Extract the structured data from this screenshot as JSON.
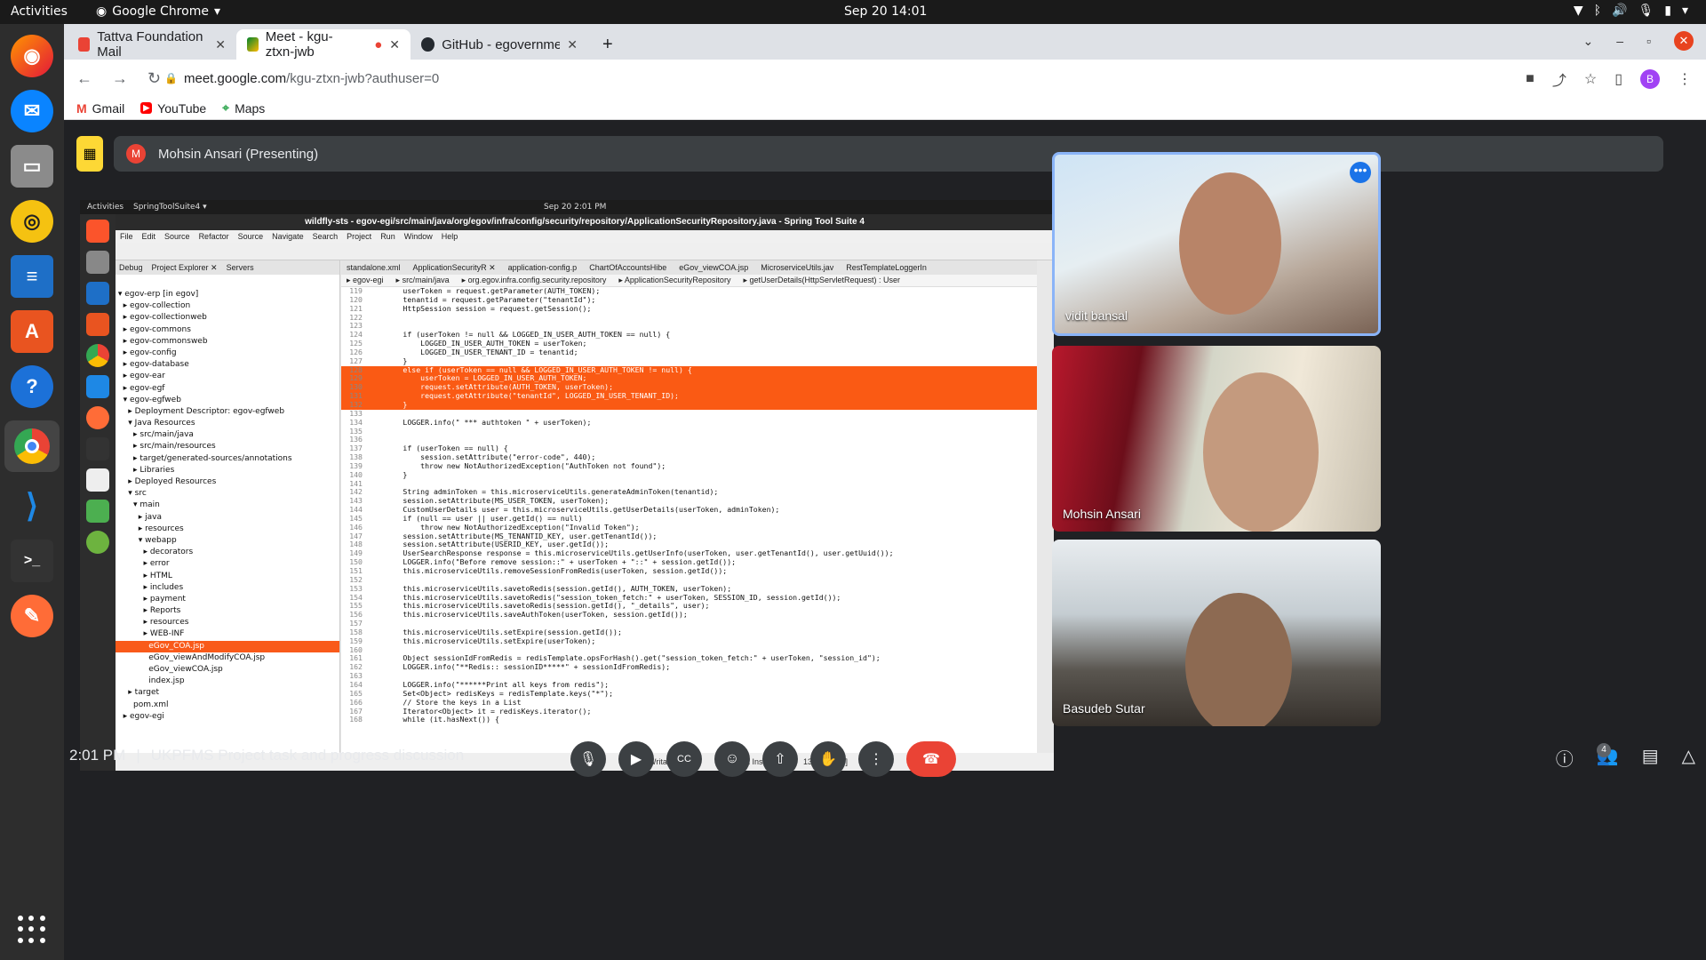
{
  "os": {
    "activities": "Activities",
    "app_name": "Google Chrome",
    "clock": "Sep 20  14:01"
  },
  "browser": {
    "tabs": [
      {
        "label": "Tattva Foundation Mail",
        "color": "#ea4335"
      },
      {
        "label": "Meet - kgu-ztxn-jwb",
        "color": "#00832d"
      },
      {
        "label": "GitHub - egovernments/c",
        "color": "#24292f"
      }
    ],
    "url_host": "meet.google.com",
    "url_path": "/kgu-ztxn-jwb?authuser=0",
    "profile": "B",
    "bookmarks": [
      "Gmail",
      "YouTube",
      "Maps"
    ]
  },
  "meet": {
    "presenter_initial": "M",
    "presenter": "Mohsin Ansari (Presenting)",
    "participants": [
      {
        "name": "vidit bansal"
      },
      {
        "name": "Mohsin Ansari"
      },
      {
        "name": "Basudeb Sutar"
      }
    ],
    "time": "2:01 PM",
    "separator": "|",
    "meeting_title": "UKPFMS Project task and progress discussion",
    "people_count": "4"
  },
  "shared": {
    "top_activities": "Activities",
    "top_app": "SpringToolSuite4 ▾",
    "top_clock": "Sep 20  2:01 PM",
    "window_title": "wildfly-sts - egov-egi/src/main/java/org/egov/infra/config/security/repository/ApplicationSecurityRepository.java - Spring Tool Suite 4",
    "menu": [
      "File",
      "Edit",
      "Source",
      "Refactor",
      "Source",
      "Navigate",
      "Search",
      "Project",
      "Run",
      "Window",
      "Help"
    ],
    "panel_tabs": [
      "Debug",
      "Project Explorer ✕",
      "Servers"
    ],
    "tree": [
      "▾ egov-erp [in egov]",
      "  ▸ egov-collection",
      "  ▸ egov-collectionweb",
      "  ▸ egov-commons",
      "  ▸ egov-commonsweb",
      "  ▸ egov-config",
      "  ▸ egov-database",
      "  ▸ egov-ear",
      "  ▸ egov-egf",
      "  ▾ egov-egfweb",
      "    ▸ Deployment Descriptor: egov-egfweb",
      "    ▾ Java Resources",
      "      ▸ src/main/java",
      "      ▸ src/main/resources",
      "      ▸ target/generated-sources/annotations",
      "      ▸ Libraries",
      "    ▸ Deployed Resources",
      "    ▾ src",
      "      ▾ main",
      "        ▸ java",
      "        ▸ resources",
      "        ▾ webapp",
      "          ▸ decorators",
      "          ▸ error",
      "          ▸ HTML",
      "          ▸ includes",
      "          ▸ payment",
      "          ▸ Reports",
      "          ▸ resources",
      "          ▸ WEB-INF",
      "            eGov_COA.jsp",
      "            eGov_viewAndModifyCOA.jsp",
      "            eGov_viewCOA.jsp",
      "            index.jsp",
      "    ▸ target",
      "      pom.xml",
      "  ▸ egov-egi"
    ],
    "selected_tree_index": 30,
    "editor_tabs": [
      "standalone.xml",
      "ApplicationSecurityR ✕",
      "application-config.p",
      "ChartOfAccountsHibe",
      "eGov_viewCOA.jsp",
      "MicroserviceUtils.jav",
      "RestTemplateLoggerIn"
    ],
    "breadcrumbs": [
      "▸ egov-egi",
      "▸ src/main/java",
      "▸ org.egov.infra.config.security.repository",
      "▸ ApplicationSecurityRepository",
      "▸ getUserDetails(HttpServletRequest) : User"
    ],
    "code": [
      {
        "n": "119",
        "t": "        userToken = request.getParameter(AUTH_TOKEN);"
      },
      {
        "n": "120",
        "t": "        tenantid = request.getParameter(\"tenantId\");"
      },
      {
        "n": "121",
        "t": "        HttpSession session = request.getSession();"
      },
      {
        "n": "122",
        "t": ""
      },
      {
        "n": "123",
        "t": ""
      },
      {
        "n": "124",
        "t": "        if (userToken != null && LOGGED_IN_USER_AUTH_TOKEN == null) {"
      },
      {
        "n": "125",
        "t": "            LOGGED_IN_USER_AUTH_TOKEN = userToken;"
      },
      {
        "n": "126",
        "t": "            LOGGED_IN_USER_TENANT_ID = tenantid;"
      },
      {
        "n": "127",
        "t": "        }"
      },
      {
        "n": "128",
        "t": "        else if (userToken == null && LOGGED_IN_USER_AUTH_TOKEN != null) {",
        "hl": true
      },
      {
        "n": "129",
        "t": "            userToken = LOGGED_IN_USER_AUTH_TOKEN;",
        "hl": true
      },
      {
        "n": "130",
        "t": "            request.setAttribute(AUTH_TOKEN, userToken);",
        "hl": true
      },
      {
        "n": "131",
        "t": "            request.getAttribute(\"tenantId\", LOGGED_IN_USER_TENANT_ID);",
        "hl": true
      },
      {
        "n": "132",
        "t": "        }",
        "hl": true
      },
      {
        "n": "133",
        "t": ""
      },
      {
        "n": "134",
        "t": "        LOGGER.info(\" *** authtoken \" + userToken);"
      },
      {
        "n": "135",
        "t": ""
      },
      {
        "n": "136",
        "t": ""
      },
      {
        "n": "137",
        "t": "        if (userToken == null) {"
      },
      {
        "n": "138",
        "t": "            session.setAttribute(\"error-code\", 440);"
      },
      {
        "n": "139",
        "t": "            throw new NotAuthorizedException(\"AuthToken not found\");"
      },
      {
        "n": "140",
        "t": "        }"
      },
      {
        "n": "141",
        "t": ""
      },
      {
        "n": "142",
        "t": "        String adminToken = this.microserviceUtils.generateAdminToken(tenantid);"
      },
      {
        "n": "143",
        "t": "        session.setAttribute(MS_USER_TOKEN, userToken);"
      },
      {
        "n": "144",
        "t": "        CustomUserDetails user = this.microserviceUtils.getUserDetails(userToken, adminToken);"
      },
      {
        "n": "145",
        "t": "        if (null == user || user.getId() == null)"
      },
      {
        "n": "146",
        "t": "            throw new NotAuthorizedException(\"Invalid Token\");"
      },
      {
        "n": "147",
        "t": "        session.setAttribute(MS_TENANTID_KEY, user.getTenantId());"
      },
      {
        "n": "148",
        "t": "        session.setAttribute(USERID_KEY, user.getId());"
      },
      {
        "n": "149",
        "t": "        UserSearchResponse response = this.microserviceUtils.getUserInfo(userToken, user.getTenantId(), user.getUuid());"
      },
      {
        "n": "150",
        "t": "        LOGGER.info(\"Before remove session::\" + userToken + \"::\" + session.getId());"
      },
      {
        "n": "151",
        "t": "        this.microserviceUtils.removeSessionFromRedis(userToken, session.getId());"
      },
      {
        "n": "152",
        "t": ""
      },
      {
        "n": "153",
        "t": "        this.microserviceUtils.savetoRedis(session.getId(), AUTH_TOKEN, userToken);"
      },
      {
        "n": "154",
        "t": "        this.microserviceUtils.savetoRedis(\"session_token_fetch:\" + userToken, SESSION_ID, session.getId());"
      },
      {
        "n": "155",
        "t": "        this.microserviceUtils.savetoRedis(session.getId(), \"_details\", user);"
      },
      {
        "n": "156",
        "t": "        this.microserviceUtils.saveAuthToken(userToken, session.getId());"
      },
      {
        "n": "157",
        "t": ""
      },
      {
        "n": "158",
        "t": "        this.microserviceUtils.setExpire(session.getId());"
      },
      {
        "n": "159",
        "t": "        this.microserviceUtils.setExpire(userToken);"
      },
      {
        "n": "160",
        "t": ""
      },
      {
        "n": "161",
        "t": "        Object sessionIdFromRedis = redisTemplate.opsForHash().get(\"session_token_fetch:\" + userToken, \"session_id\");"
      },
      {
        "n": "162",
        "t": "        LOGGER.info(\"**Redis:: sessionID*****\" + sessionIdFromRedis);"
      },
      {
        "n": "163",
        "t": ""
      },
      {
        "n": "164",
        "t": "        LOGGER.info(\"******Print all keys from redis\");"
      },
      {
        "n": "165",
        "t": "        Set<Object> redisKeys = redisTemplate.keys(\"*\");"
      },
      {
        "n": "166",
        "t": "        // Store the keys in a List"
      },
      {
        "n": "167",
        "t": "        Iterator<Object> it = redisKeys.iterator();"
      },
      {
        "n": "168",
        "t": "        while (it.hasNext()) {"
      }
    ],
    "status": {
      "mode": "Writable",
      "insert": "Smart Insert",
      "pos": "133 : 1 [224]"
    }
  },
  "colors": {
    "accent_highlight": "#fa5a14",
    "end_call": "#ea4335",
    "meet_bg": "#202124"
  },
  "icons": [
    "mic-icon",
    "camera-icon",
    "captions-icon",
    "emoji-icon",
    "present-icon",
    "raise-hand-icon",
    "more-icon",
    "end-call-icon",
    "info-icon",
    "people-icon",
    "chat-icon",
    "activities-icon"
  ]
}
